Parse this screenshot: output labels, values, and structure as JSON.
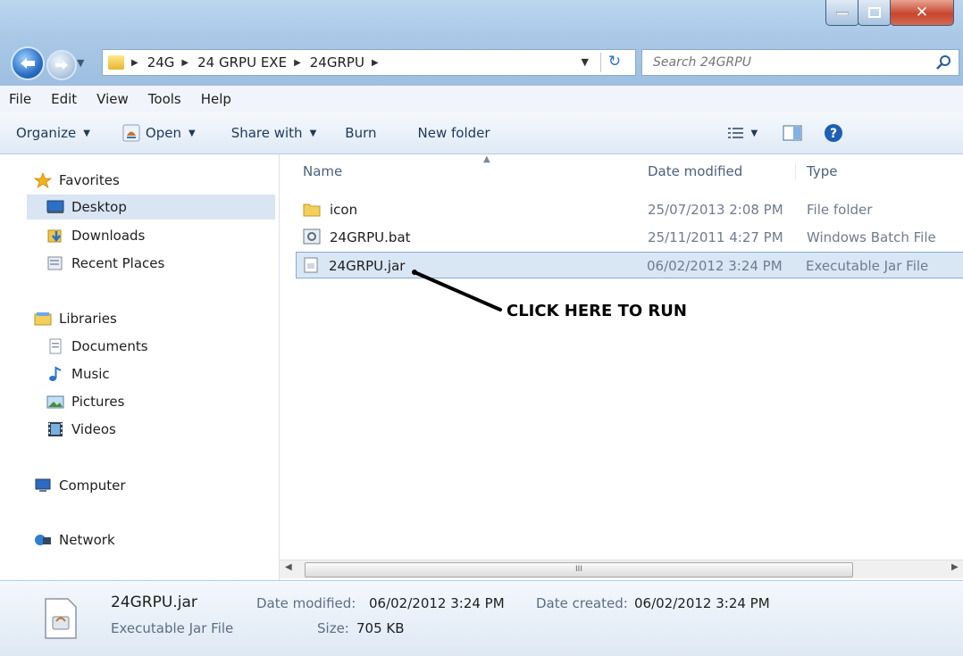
{
  "address": {
    "crumbs": [
      "24G",
      "24 GRPU EXE",
      "24GRPU"
    ]
  },
  "search": {
    "placeholder": "Search 24GRPU"
  },
  "menu": [
    "File",
    "Edit",
    "View",
    "Tools",
    "Help"
  ],
  "toolbar": {
    "organize": "Organize",
    "open": "Open",
    "share_with": "Share with",
    "burn": "Burn",
    "new_folder": "New folder"
  },
  "nav": {
    "favorites": "Favorites",
    "desktop": "Desktop",
    "downloads": "Downloads",
    "recent_places": "Recent Places",
    "libraries": "Libraries",
    "documents": "Documents",
    "music": "Music",
    "pictures": "Pictures",
    "videos": "Videos",
    "computer": "Computer",
    "network": "Network"
  },
  "columns": {
    "name": "Name",
    "date_modified": "Date modified",
    "type": "Type"
  },
  "files": [
    {
      "name": "icon",
      "date": "25/07/2013 2:08 PM",
      "type": "File folder",
      "icon": "folder-icon"
    },
    {
      "name": "24GRPU.bat",
      "date": "25/11/2011 4:27 PM",
      "type": "Windows Batch File",
      "icon": "batch-file-icon"
    },
    {
      "name": "24GRPU.jar",
      "date": "06/02/2012 3:24 PM",
      "type": "Executable Jar File",
      "icon": "jar-file-icon",
      "selected": true
    }
  ],
  "annotation": "CLICK HERE TO RUN",
  "scroll_label": "III",
  "details": {
    "filename": "24GRPU.jar",
    "filetype": "Executable Jar File",
    "date_modified_label": "Date modified:",
    "date_modified": "06/02/2012 3:24 PM",
    "date_created_label": "Date created:",
    "date_created": "06/02/2012 3:24 PM",
    "size_label": "Size:",
    "size": "705 KB"
  }
}
